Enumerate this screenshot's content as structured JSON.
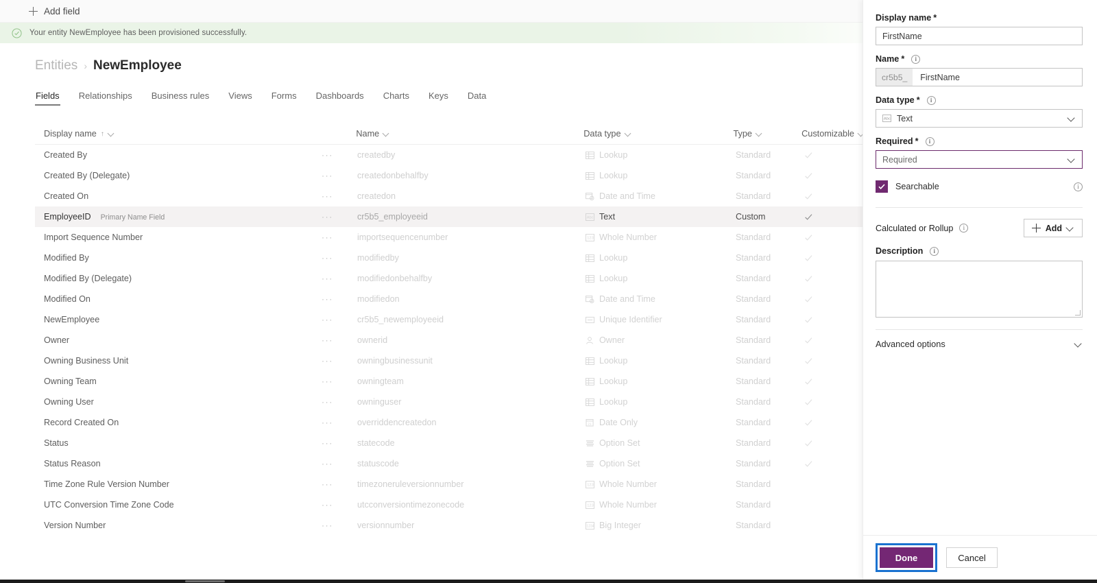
{
  "commandbar": {
    "add_field_label": "Add field",
    "add_field_icon": "plus-icon"
  },
  "notification": {
    "icon": "check-circle-icon",
    "message": "Your entity NewEmployee has been provisioned successfully."
  },
  "breadcrumb": {
    "root": "Entities",
    "separator": "›",
    "current": "NewEmployee"
  },
  "tabs": [
    {
      "label": "Fields",
      "active": true
    },
    {
      "label": "Relationships",
      "active": false
    },
    {
      "label": "Business rules",
      "active": false
    },
    {
      "label": "Views",
      "active": false
    },
    {
      "label": "Forms",
      "active": false
    },
    {
      "label": "Dashboards",
      "active": false
    },
    {
      "label": "Charts",
      "active": false
    },
    {
      "label": "Keys",
      "active": false
    },
    {
      "label": "Data",
      "active": false
    }
  ],
  "table": {
    "columns": [
      {
        "label": "Display name",
        "sort": "↑",
        "menu_icon": "chevron-down-icon"
      },
      {
        "label": "Name",
        "menu_icon": "chevron-down-icon"
      },
      {
        "label": "Data type",
        "menu_icon": "chevron-down-icon"
      },
      {
        "label": "Type",
        "menu_icon": "chevron-down-icon"
      },
      {
        "label": "Customizable",
        "menu_icon": "chevron-down-icon"
      }
    ],
    "overflow_glyph": "···",
    "rows": [
      {
        "display": "Created By",
        "tag": "",
        "name": "createdby",
        "datatype": "Lookup",
        "icon": "lookup-icon",
        "type": "Standard",
        "customizable": true,
        "selected": false
      },
      {
        "display": "Created By (Delegate)",
        "tag": "",
        "name": "createdonbehalfby",
        "datatype": "Lookup",
        "icon": "lookup-icon",
        "type": "Standard",
        "customizable": true,
        "selected": false
      },
      {
        "display": "Created On",
        "tag": "",
        "name": "createdon",
        "datatype": "Date and Time",
        "icon": "datetime-icon",
        "type": "Standard",
        "customizable": true,
        "selected": false
      },
      {
        "display": "EmployeeID",
        "tag": "Primary Name Field",
        "name": "cr5b5_employeeid",
        "datatype": "Text",
        "icon": "text-icon",
        "type": "Custom",
        "customizable": true,
        "selected": true
      },
      {
        "display": "Import Sequence Number",
        "tag": "",
        "name": "importsequencenumber",
        "datatype": "Whole Number",
        "icon": "number-icon",
        "type": "Standard",
        "customizable": true,
        "selected": false
      },
      {
        "display": "Modified By",
        "tag": "",
        "name": "modifiedby",
        "datatype": "Lookup",
        "icon": "lookup-icon",
        "type": "Standard",
        "customizable": true,
        "selected": false
      },
      {
        "display": "Modified By (Delegate)",
        "tag": "",
        "name": "modifiedonbehalfby",
        "datatype": "Lookup",
        "icon": "lookup-icon",
        "type": "Standard",
        "customizable": true,
        "selected": false
      },
      {
        "display": "Modified On",
        "tag": "",
        "name": "modifiedon",
        "datatype": "Date and Time",
        "icon": "datetime-icon",
        "type": "Standard",
        "customizable": true,
        "selected": false
      },
      {
        "display": "NewEmployee",
        "tag": "",
        "name": "cr5b5_newemployeeid",
        "datatype": "Unique Identifier",
        "icon": "guid-icon",
        "type": "Standard",
        "customizable": true,
        "selected": false
      },
      {
        "display": "Owner",
        "tag": "",
        "name": "ownerid",
        "datatype": "Owner",
        "icon": "owner-icon",
        "type": "Standard",
        "customizable": true,
        "selected": false
      },
      {
        "display": "Owning Business Unit",
        "tag": "",
        "name": "owningbusinessunit",
        "datatype": "Lookup",
        "icon": "lookup-icon",
        "type": "Standard",
        "customizable": true,
        "selected": false
      },
      {
        "display": "Owning Team",
        "tag": "",
        "name": "owningteam",
        "datatype": "Lookup",
        "icon": "lookup-icon",
        "type": "Standard",
        "customizable": true,
        "selected": false
      },
      {
        "display": "Owning User",
        "tag": "",
        "name": "owninguser",
        "datatype": "Lookup",
        "icon": "lookup-icon",
        "type": "Standard",
        "customizable": true,
        "selected": false
      },
      {
        "display": "Record Created On",
        "tag": "",
        "name": "overriddencreatedon",
        "datatype": "Date Only",
        "icon": "dateonly-icon",
        "type": "Standard",
        "customizable": true,
        "selected": false
      },
      {
        "display": "Status",
        "tag": "",
        "name": "statecode",
        "datatype": "Option Set",
        "icon": "optionset-icon",
        "type": "Standard",
        "customizable": true,
        "selected": false
      },
      {
        "display": "Status Reason",
        "tag": "",
        "name": "statuscode",
        "datatype": "Option Set",
        "icon": "optionset-icon",
        "type": "Standard",
        "customizable": true,
        "selected": false
      },
      {
        "display": "Time Zone Rule Version Number",
        "tag": "",
        "name": "timezoneruleversionnumber",
        "datatype": "Whole Number",
        "icon": "number-icon",
        "type": "Standard",
        "customizable": false,
        "selected": false
      },
      {
        "display": "UTC Conversion Time Zone Code",
        "tag": "",
        "name": "utcconversiontimezonecode",
        "datatype": "Whole Number",
        "icon": "number-icon",
        "type": "Standard",
        "customizable": false,
        "selected": false
      },
      {
        "display": "Version Number",
        "tag": "",
        "name": "versionnumber",
        "datatype": "Big Integer",
        "icon": "biginteger-icon",
        "type": "Standard",
        "customizable": false,
        "selected": false
      }
    ]
  },
  "panel": {
    "display_name": {
      "label": "Display name",
      "required_mark": "*",
      "value": "FirstName"
    },
    "name": {
      "label": "Name",
      "required_mark": "*",
      "info_icon": "info-icon",
      "prefix": "cr5b5_",
      "value": "FirstName"
    },
    "data_type": {
      "label": "Data type",
      "required_mark": "*",
      "info_icon": "info-icon",
      "value": "Text",
      "value_icon": "text-icon",
      "chevron": "chevron-down-icon"
    },
    "required": {
      "label": "Required",
      "required_mark": "*",
      "info_icon": "info-icon",
      "value": "Required",
      "chevron": "chevron-down-icon"
    },
    "searchable": {
      "label": "Searchable",
      "checked": true,
      "info_icon": "info-icon",
      "check_icon": "check-icon"
    },
    "calculated": {
      "label": "Calculated or Rollup",
      "info_icon": "info-icon",
      "add_label": "Add",
      "add_icon": "plus-icon",
      "chevron": "chevron-down-icon"
    },
    "description": {
      "label": "Description",
      "info_icon": "info-icon",
      "value": "",
      "placeholder": ""
    },
    "advanced": {
      "label": "Advanced options",
      "chevron": "chevron-down-icon"
    },
    "footer": {
      "done_label": "Done",
      "cancel_label": "Cancel"
    }
  },
  "colors": {
    "brand_purple": "#742774",
    "focus_purple": "#6b2a6b",
    "highlight_blue": "#1a72d0",
    "success_green_bg": "#eaf4e7",
    "selected_row": "#f4f2f2"
  }
}
